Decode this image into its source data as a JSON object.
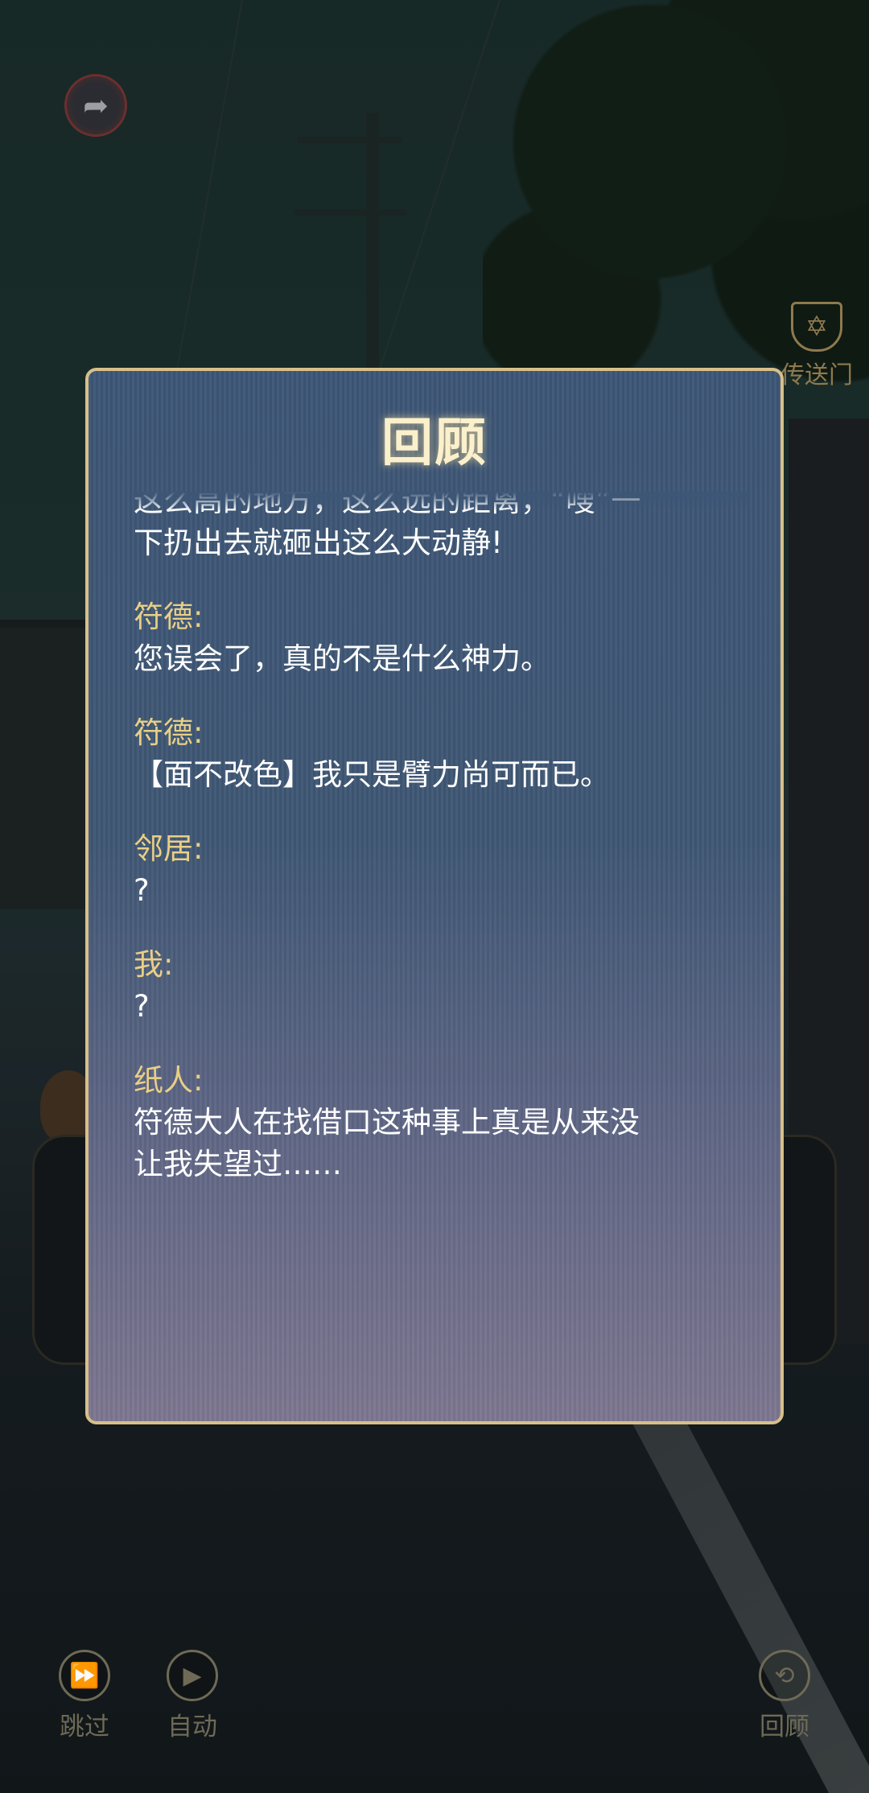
{
  "hud": {
    "back_icon": "back-arrow-icon",
    "portal": {
      "icon": "star-shrine-icon",
      "label": "传送门"
    }
  },
  "review": {
    "title": "回顾",
    "entries": [
      {
        "speaker": "",
        "lines": [
          "这么高的地方，这么远的距离，“嗖”一",
          "下扔出去就砸出这么大动静!"
        ]
      },
      {
        "speaker": "符德:",
        "lines": [
          "您误会了，真的不是什么神力。"
        ]
      },
      {
        "speaker": "符德:",
        "lines": [
          "【面不改色】我只是臂力尚可而已。"
        ]
      },
      {
        "speaker": "邻居:",
        "lines": [
          "?"
        ]
      },
      {
        "speaker": "我:",
        "lines": [
          "?"
        ]
      },
      {
        "speaker": "纸人:",
        "lines": [
          "符德大人在找借口这种事上真是从来没",
          "让我失望过……"
        ]
      }
    ]
  },
  "controls": {
    "skip": {
      "label": "跳过",
      "icon": "fast-forward-icon"
    },
    "auto": {
      "label": "自动",
      "icon": "play-icon"
    },
    "review": {
      "label": "回顾",
      "icon": "rewind-icon"
    }
  },
  "colors": {
    "frame": "#d8bf8a",
    "speaker": "#e9cf86",
    "text": "#ffffff"
  }
}
